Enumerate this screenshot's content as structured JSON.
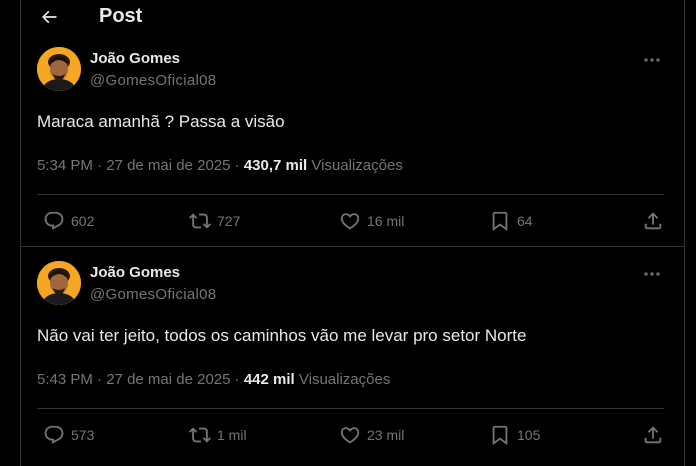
{
  "header": {
    "title": "Post",
    "back_icon": "arrow-left-icon"
  },
  "colors": {
    "background": "#000000",
    "text": "#e7e9ea",
    "muted": "#71767b",
    "divider": "#2f3336",
    "avatar_bg": "#f5a623"
  },
  "posts": [
    {
      "author": {
        "name": "João Gomes",
        "handle": "@GomesOficial08"
      },
      "text": "Maraca amanhã ? Passa a visão",
      "meta": {
        "time": "5:34 PM",
        "separator": "·",
        "date": "27 de mai de 2025",
        "separator2": "·",
        "views": "430,7 mil",
        "views_label": "Visualizações"
      },
      "actions": {
        "replies": "602",
        "reposts": "727",
        "likes": "16 mil",
        "bookmarks": "64"
      }
    },
    {
      "author": {
        "name": "João Gomes",
        "handle": "@GomesOficial08"
      },
      "text": "Não vai ter jeito, todos os caminhos vão me levar pro setor Norte",
      "meta": {
        "time": "5:43 PM",
        "separator": "·",
        "date": "27 de mai de 2025",
        "separator2": "·",
        "views": "442 mil",
        "views_label": "Visualizações"
      },
      "actions": {
        "replies": "573",
        "reposts": "1 mil",
        "likes": "23 mil",
        "bookmarks": "105"
      }
    }
  ]
}
